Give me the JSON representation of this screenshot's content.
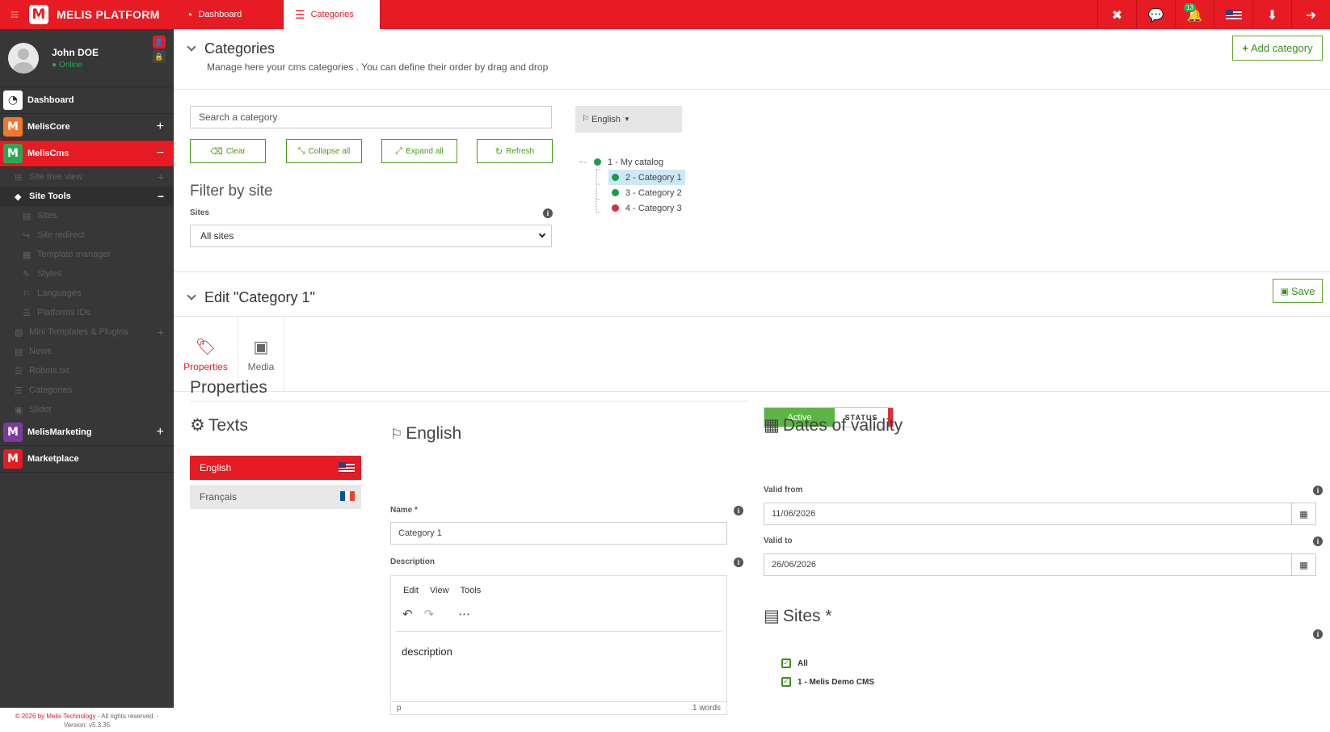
{
  "topbar": {
    "brand": "MELIS PLATFORM",
    "tabs": [
      {
        "label": "Dashboard",
        "icon": "dashboard-icon"
      },
      {
        "label": "Categories",
        "icon": "list-icon"
      }
    ],
    "notification_count": "13",
    "buttons": [
      "close-icon",
      "chat-icon",
      "bell-icon",
      "us-flag-icon",
      "download-icon",
      "logout-icon"
    ]
  },
  "user": {
    "name": "John DOE",
    "status": "Online"
  },
  "sidebar": {
    "items": [
      {
        "label": "Dashboard",
        "icon": "dashboard-icon",
        "color": "#373737"
      },
      {
        "label": "MelisCore",
        "icon": "melis-logo-icon",
        "color": "#f4752c",
        "toggle": "+"
      },
      {
        "label": "MelisCms",
        "icon": "melis-logo-icon",
        "color": "#2aa755",
        "toggle": "−"
      },
      {
        "label": "MelisMarketing",
        "icon": "melis-logo-icon",
        "color": "#7a3b9c",
        "toggle": "+"
      },
      {
        "label": "Marketplace",
        "icon": "melis-logo-icon",
        "color": "#e61b23"
      }
    ],
    "cms_subitems": [
      {
        "label": "Site tree view",
        "toggle": "+"
      },
      {
        "label": "Site Tools",
        "toggle": "−"
      },
      {
        "label": "Sites"
      },
      {
        "label": "Site redirect"
      },
      {
        "label": "Template manager"
      },
      {
        "label": "Styles"
      },
      {
        "label": "Languages"
      },
      {
        "label": "Platforms IDs"
      },
      {
        "label": "Mini Templates & Plugins",
        "toggle": "+"
      },
      {
        "label": "News"
      },
      {
        "label": "Robots.txt"
      },
      {
        "label": "Categories"
      },
      {
        "label": "Slider"
      }
    ],
    "footer_copy": "© 2026 by Melis Technology",
    "footer_rights": " - All rights reserved. -",
    "footer_version": "Version: v5.3.35"
  },
  "header": {
    "title": "Categories",
    "subtitle": "Manage here your cms categories . You can define their order by drag and drop",
    "add_button": "Add category"
  },
  "filters": {
    "search_placeholder": "Search a category",
    "buttons": [
      "Clear",
      "Collapse all",
      "Expand all",
      "Refresh"
    ],
    "filter_title": "Filter by site",
    "sites_label": "Sites",
    "sites_value": "All sites",
    "language": "English"
  },
  "tree": [
    {
      "label": "1 - My catalog",
      "status": "active"
    },
    {
      "label": "2 - Category 1",
      "status": "active",
      "selected": true
    },
    {
      "label": "3 - Category 2",
      "status": "active"
    },
    {
      "label": "4 - Category 3",
      "status": "inactive"
    }
  ],
  "colors": {
    "active": "#1e9a4e",
    "inactive": "#d9303a",
    "brand": "#e61b23",
    "green": "#4c9c1a"
  },
  "edit": {
    "title": "Edit \"Category 1\"",
    "save": "Save",
    "tabs": [
      "Properties",
      "Media"
    ],
    "section_title": "Properties",
    "status_active": "Active",
    "status_label": "STATUS",
    "texts_title": "Texts",
    "languages": [
      "English",
      "Français"
    ],
    "english_title": "English",
    "name_label": "Name *",
    "name_value": "Category 1",
    "description_label": "Description",
    "editor_menu": [
      "Edit",
      "View",
      "Tools"
    ],
    "description_value": "description",
    "editor_path": "p",
    "editor_words": "1 words",
    "dates_title": "Dates of validity",
    "valid_from_label": "Valid from",
    "valid_from": "11/06/2026",
    "valid_to_label": "Valid to",
    "valid_to": "26/06/2026",
    "sites_title": "Sites *",
    "sites": [
      "All",
      "1 - Melis Demo CMS"
    ]
  }
}
